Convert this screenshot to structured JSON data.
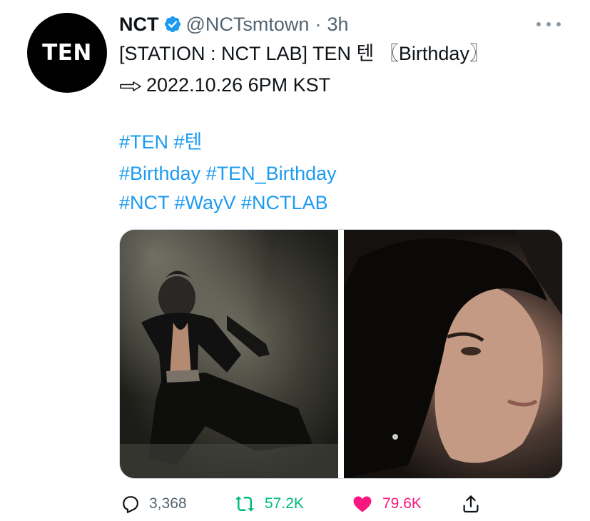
{
  "tweet": {
    "avatar_text": "TEN",
    "author_name": "NCT",
    "handle": "@NCTsmtown",
    "separator": "·",
    "time": "3h",
    "line1": "[STATION : NCT LAB] TEN 텐 〖Birthday〗",
    "line2": "2022.10.26 6PM KST",
    "hashtags_line1": "#TEN #텐",
    "hashtags_line2": "#Birthday #TEN_Birthday",
    "hashtags_line3": "#NCT #WayV #NCTLAB"
  },
  "actions": {
    "replies": "3,368",
    "retweets": "57.2K",
    "likes": "79.6K"
  },
  "icons": [
    "verified-badge-icon",
    "more-options-icon",
    "right-arrow-icon",
    "reply-icon",
    "retweet-icon",
    "heart-icon",
    "share-icon"
  ],
  "colors": {
    "link": "#1d9bf0",
    "secondary_text": "#536471",
    "retweet": "#00ba7c",
    "like": "#f91880",
    "verified": "#1d9bf0"
  }
}
